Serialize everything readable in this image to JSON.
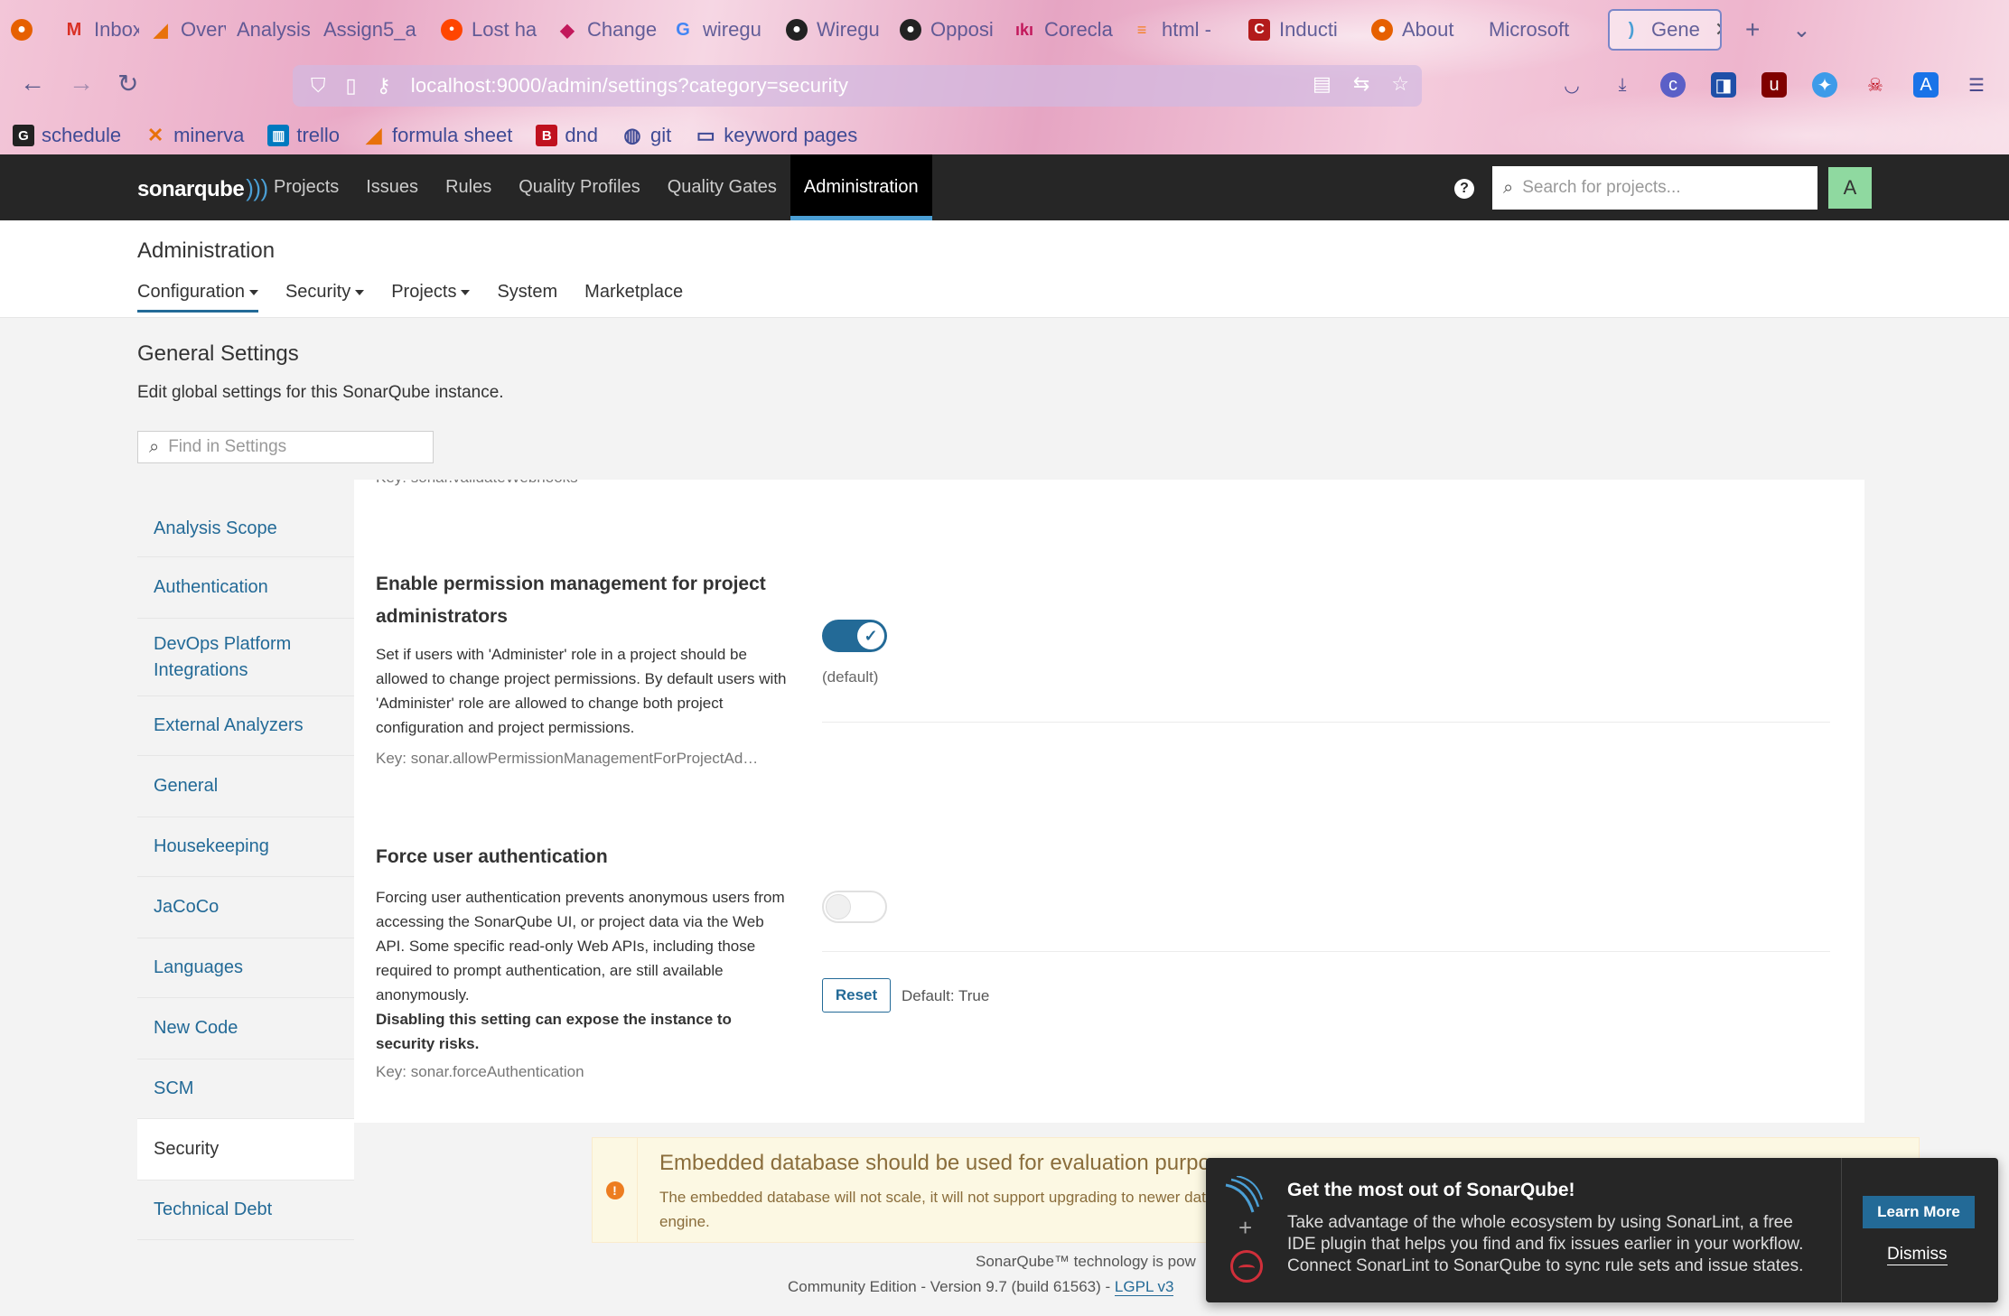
{
  "browser": {
    "tabs": [
      {
        "label": "",
        "icon": "firefox-icon",
        "color": "#e66000"
      },
      {
        "label": "Inbox (",
        "icon": "gmail-icon",
        "color": "#d93025"
      },
      {
        "label": "Overvi",
        "icon": "triangle-icon",
        "color": "#e8710a"
      },
      {
        "label": "Analysis o",
        "icon": "",
        "color": ""
      },
      {
        "label": "Assign5_a",
        "icon": "",
        "color": ""
      },
      {
        "label": "Lost ha",
        "icon": "reddit-icon",
        "color": "#ff4500"
      },
      {
        "label": "Change",
        "icon": "doc-icon",
        "color": "#c2185b"
      },
      {
        "label": "wiregu",
        "icon": "google-icon",
        "color": "#4285f4"
      },
      {
        "label": "Wiregu",
        "icon": "github-icon",
        "color": "#222222"
      },
      {
        "label": "Opposi",
        "icon": "github-icon",
        "color": "#222222"
      },
      {
        "label": "Corecla",
        "icon": "kiki-icon",
        "color": "#c2185b"
      },
      {
        "label": "html - ",
        "icon": "stackoverflow-icon",
        "color": "#f48024"
      },
      {
        "label": "Inducti",
        "icon": "c-icon",
        "color": "#b31b1b"
      },
      {
        "label": "About ",
        "icon": "firefox-icon",
        "color": "#e66000"
      },
      {
        "label": "Microsoft",
        "icon": "",
        "color": ""
      },
      {
        "label": "Gene",
        "icon": "sonar-icon",
        "color": "#4b9fd5"
      }
    ],
    "url": "localhost:9000/admin/settings?category=security",
    "bookmarks": [
      {
        "label": "schedule",
        "icon": "schedule-icon",
        "glyph": "G",
        "color": "#222222"
      },
      {
        "label": "minerva",
        "icon": "minerva-icon",
        "glyph": "✕",
        "color": "#e8710a"
      },
      {
        "label": "trello",
        "icon": "trello-icon",
        "glyph": "▥",
        "color": "#0079bf"
      },
      {
        "label": "formula sheet",
        "icon": "triangle-icon",
        "glyph": "◢",
        "color": "#e8710a"
      },
      {
        "label": "dnd",
        "icon": "dnd-icon",
        "glyph": "B",
        "color": "#c0111f"
      },
      {
        "label": "git",
        "icon": "globe-icon",
        "glyph": "◍",
        "color": "#3f4a95"
      },
      {
        "label": "keyword pages",
        "icon": "folder-icon",
        "glyph": "▭",
        "color": "#3f4a95"
      }
    ]
  },
  "sq": {
    "logo": "sonarqube",
    "menu": [
      "Projects",
      "Issues",
      "Rules",
      "Quality Profiles",
      "Quality Gates",
      "Administration"
    ],
    "search_placeholder": "Search for projects...",
    "avatar": "A"
  },
  "admin": {
    "title": "Administration",
    "tabs": [
      "Configuration",
      "Security",
      "Projects",
      "System",
      "Marketplace"
    ]
  },
  "general": {
    "title": "General Settings",
    "description": "Edit global settings for this SonarQube instance.",
    "find_placeholder": "Find in Settings"
  },
  "categories": [
    "Analysis Scope",
    "Authentication",
    "DevOps Platform Integrations",
    "External Analyzers",
    "General",
    "Housekeeping",
    "JaCoCo",
    "Languages",
    "New Code",
    "SCM",
    "Security",
    "Technical Debt"
  ],
  "settings": {
    "cut_key": "Key: sonar.validateWebhooks",
    "perm": {
      "title": "Enable permission management for project administrators",
      "desc": "Set if users with 'Administer' role in a project should be allowed to change project permissions. By default users with 'Administer' role are allowed to change both project configuration and project permissions.",
      "key": "Key: sonar.allowPermissionManagementForProjectAd…",
      "toggle_on": true,
      "default_note": "(default)"
    },
    "force": {
      "title": "Force user authentication",
      "desc": "Forcing user authentication prevents anonymous users from accessing the SonarQube UI, or project data via the Web API. Some specific read-only Web APIs, including those required to prompt authentication, are still available anonymously.",
      "warning": "Disabling this setting can expose the instance to security risks.",
      "key": "Key: sonar.forceAuthentication",
      "toggle_on": false,
      "reset": "Reset",
      "default_value": "Default: True"
    }
  },
  "warning": {
    "title": "Embedded database should be used for evaluation purpo",
    "text": "The embedded database will not scale, it will not support upgrading to newer database engine."
  },
  "footer": {
    "line1": "SonarQube™ technology is pow",
    "line2_prefix": "Community Edition - Version 9.7 (build 61563) -",
    "license": "LGPL v3"
  },
  "promo": {
    "title": "Get the most out of SonarQube!",
    "text": "Take advantage of the whole ecosystem by using SonarLint, a free IDE plugin that helps you find and fix issues earlier in your workflow. Connect SonarLint to SonarQube to sync rule sets and issue states.",
    "learn_more": "Learn More",
    "dismiss": "Dismiss"
  },
  "colors": {
    "accent": "#236a97",
    "nav_bg": "#262626",
    "warn_bg": "#fcf8e3"
  }
}
